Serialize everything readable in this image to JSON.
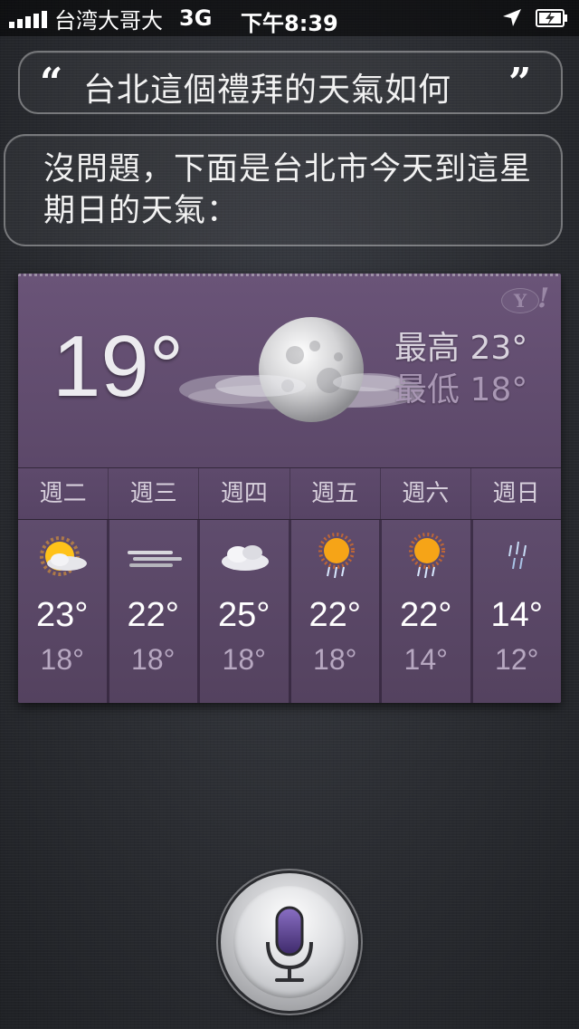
{
  "status_bar": {
    "carrier": "台湾大哥大",
    "network": "3G",
    "time": "下午8:39",
    "icons": [
      "signal-icon",
      "location-arrow-icon",
      "battery-charging-icon"
    ]
  },
  "conversation": {
    "query_open_quote": "“",
    "query": "台北這個禮拜的天氣如何",
    "query_close_quote": "”",
    "answer": "沒問題，下面是台北市今天到這星期日的天氣："
  },
  "weather": {
    "provider_logo_letter": "Y",
    "provider_logo_mark": "!",
    "current_temp": "19°",
    "current_icon": "moon-cloudy-icon",
    "high_label": "最高",
    "high_value": "23°",
    "low_label": "最低",
    "low_value": "18°",
    "forecast": [
      {
        "day": "週二",
        "icon": "sun-partly-cloudy-icon",
        "high": "23°",
        "low": "18°"
      },
      {
        "day": "週三",
        "icon": "wind-icon",
        "high": "22°",
        "low": "18°"
      },
      {
        "day": "週四",
        "icon": "cloudy-icon",
        "high": "25°",
        "low": "18°"
      },
      {
        "day": "週五",
        "icon": "sun-rain-icon",
        "high": "22°",
        "low": "18°"
      },
      {
        "day": "週六",
        "icon": "sun-rain-icon",
        "high": "22°",
        "low": "14°"
      },
      {
        "day": "週日",
        "icon": "rain-icon",
        "high": "14°",
        "low": "12°"
      }
    ]
  },
  "siri": {
    "mic_icon": "microphone-icon",
    "accent": "#5a3f8a"
  }
}
